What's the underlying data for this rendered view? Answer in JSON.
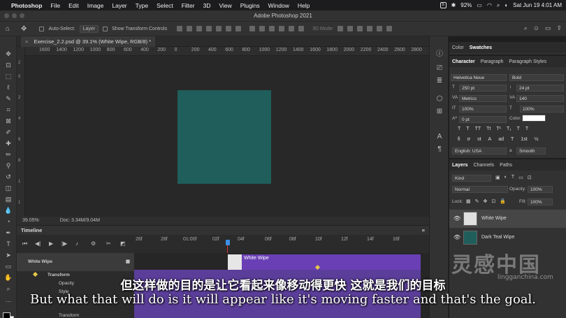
{
  "menubar": {
    "app": "Photoshop",
    "items": [
      "File",
      "Edit",
      "Image",
      "Layer",
      "Type",
      "Select",
      "Filter",
      "3D",
      "View",
      "Plugins",
      "Window",
      "Help"
    ],
    "battery": "92%",
    "datetime": "Sat Jun 19  4:01 AM"
  },
  "window": {
    "title": "Adobe Photoshop 2021"
  },
  "options": {
    "auto_select_label": "Auto-Select:",
    "auto_select_value": "Layer",
    "show_transform": "Show Transform Controls",
    "mode_3d": "3D Mode:"
  },
  "document": {
    "tab_title": "Exercise_2.2.psd @ 39.1% (White Wipe, RGB/8) *",
    "zoom": "39.05%",
    "doc_size": "Doc: 3.34M/9.04M",
    "ruler_h": [
      "1600",
      "1400",
      "1200",
      "1000",
      "800",
      "600",
      "400",
      "200",
      "0",
      "200",
      "400",
      "600",
      "800",
      "1000",
      "1200",
      "1400",
      "1600",
      "1800",
      "2000",
      "2200",
      "2400",
      "2600",
      "2800"
    ],
    "artboard_color": "#1f5e5a"
  },
  "timeline": {
    "title": "Timeline",
    "ticks": [
      "26f",
      "28f",
      "01:00f",
      "02f",
      "04f",
      "06f",
      "08f",
      "10f",
      "12f",
      "14f",
      "16f"
    ],
    "layer_name": "White Wipe",
    "clip_label": "White Wipe",
    "props": [
      "Transform",
      "Opacity",
      "Style"
    ],
    "bottom_prop": "Transform"
  },
  "swatches_panel": {
    "tabs": [
      "Color",
      "Swatches"
    ]
  },
  "character": {
    "tabs": [
      "Character",
      "Paragraph",
      "Paragraph Styles"
    ],
    "font_family": "Helvetica Neue",
    "font_style": "Bold",
    "font_size": "250 pt",
    "leading": "24 pt",
    "kerning": "Metrics",
    "tracking": "140",
    "vscale": "100%",
    "hscale": "100%",
    "baseline": "0 pt",
    "color_label": "Color:",
    "language": "English: USA",
    "antialias": "Smooth",
    "aa_code": "a"
  },
  "layers": {
    "tabs": [
      "Layers",
      "Channels",
      "Paths"
    ],
    "filter": "Kind",
    "blend": "Normal",
    "opacity_label": "Opacity:",
    "opacity": "100%",
    "lock_label": "Lock:",
    "fill_label": "Fill:",
    "fill": "100%",
    "items": [
      {
        "name": "White Wipe",
        "color": "#e0e0e0"
      },
      {
        "name": "Dark Teal Wipe",
        "color": "#1f5e5a"
      }
    ]
  },
  "subtitles": {
    "cn": "但这样做的目的是让它看起来像移动得更快 这就是我们的目标",
    "en": "But what that will do is it will appear like it's moving faster and that's the goal."
  },
  "watermark": {
    "text": "灵感中国",
    "url": "lingganchina.com"
  }
}
